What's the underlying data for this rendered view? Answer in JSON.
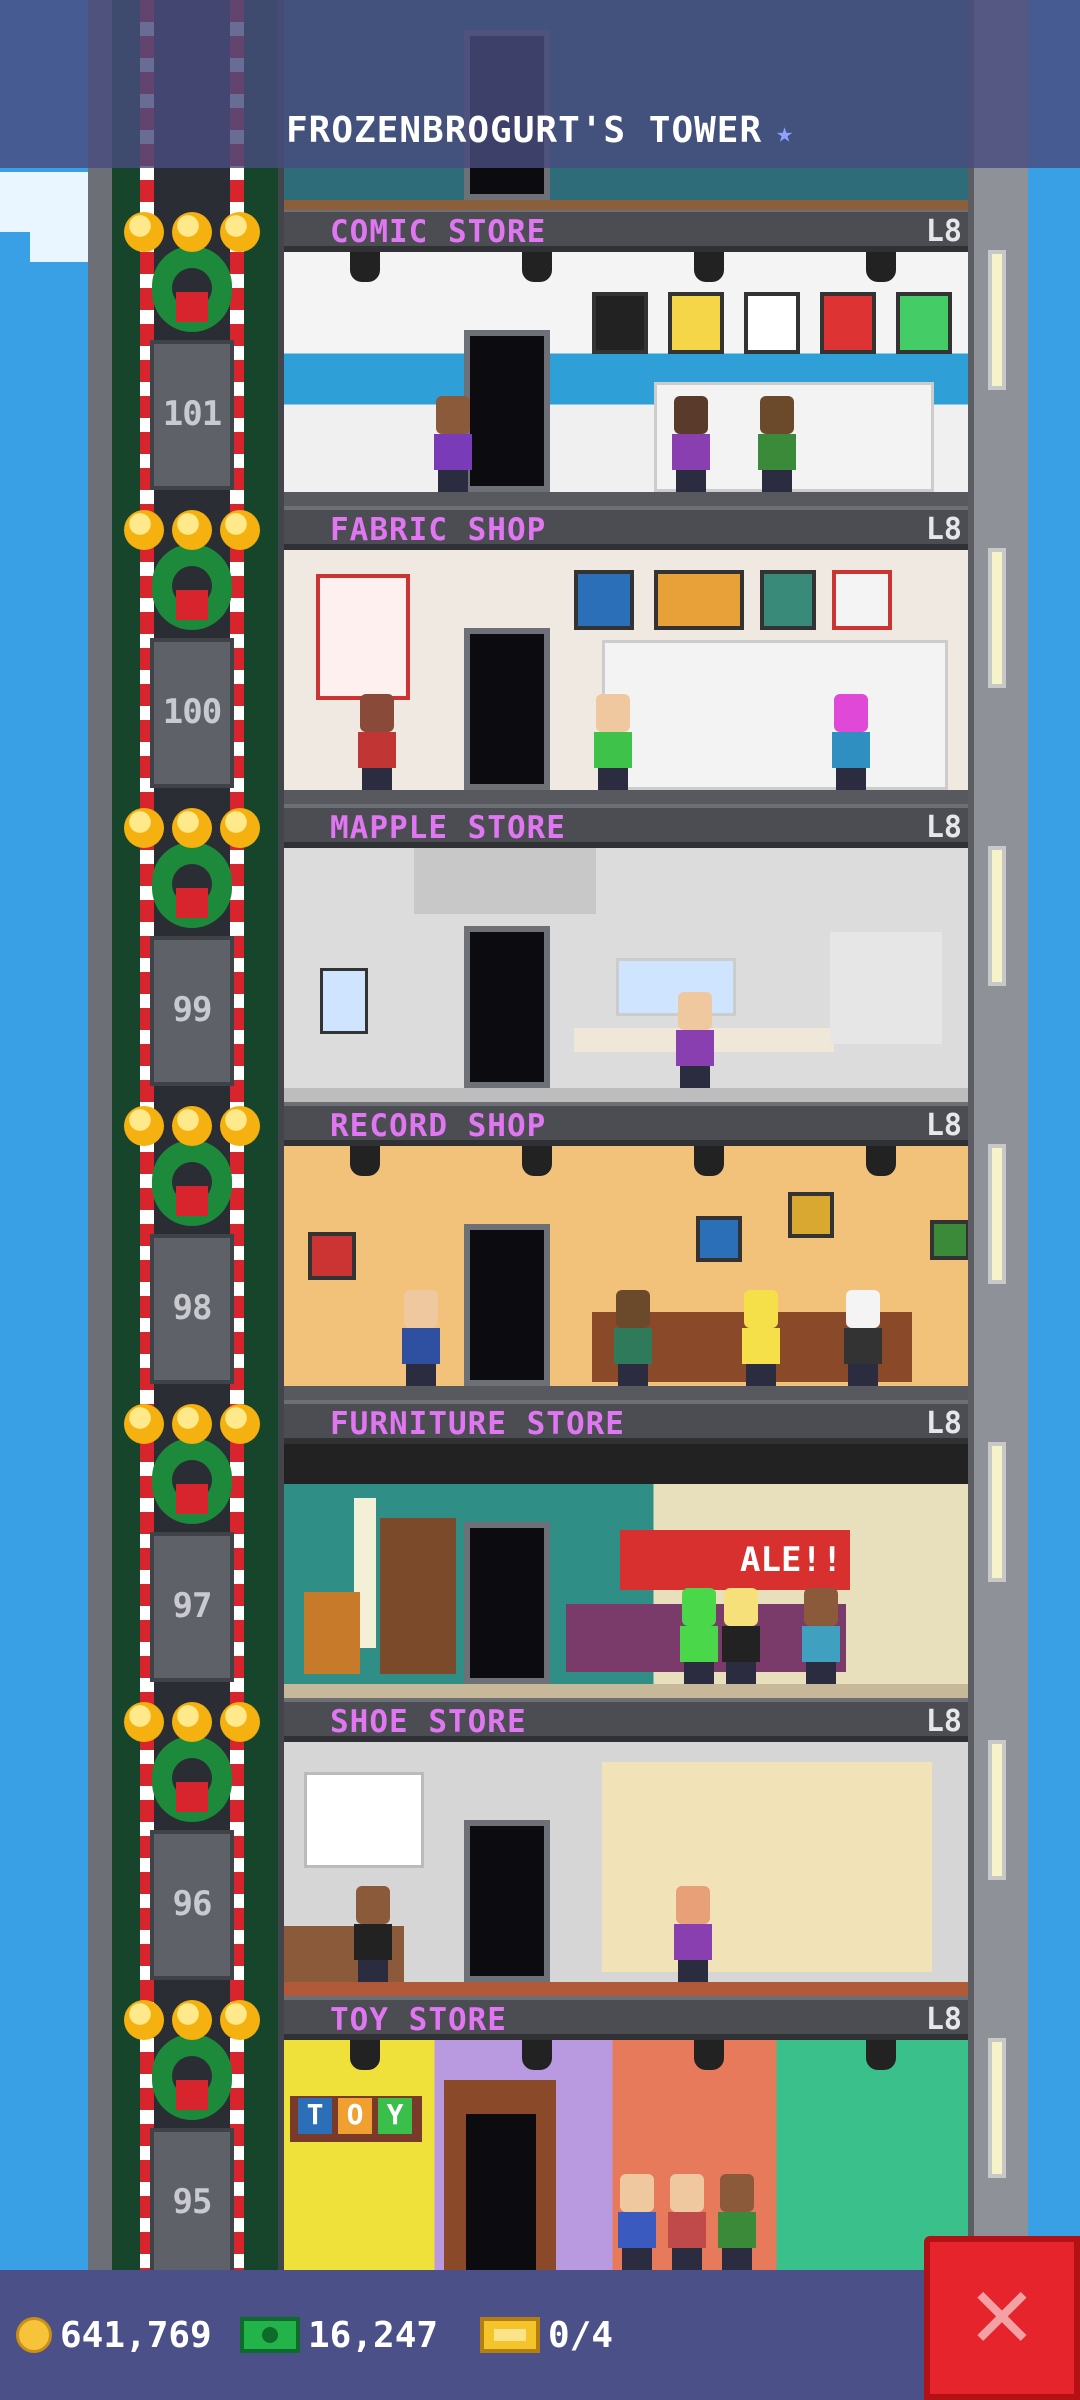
{
  "header": {
    "title": "FROZENBROGURT'S TOWER",
    "title_icon": "star-icon"
  },
  "elevator": {
    "floor_numbers": [
      "101",
      "100",
      "99",
      "98",
      "97",
      "96",
      "95"
    ]
  },
  "floors": [
    {
      "name": "COMIC STORE",
      "level": "L8"
    },
    {
      "name": "FABRIC SHOP",
      "level": "L8"
    },
    {
      "name": "MAPPLE STORE",
      "level": "L8"
    },
    {
      "name": "RECORD SHOP",
      "level": "L8"
    },
    {
      "name": "FURNITURE STORE",
      "level": "L8"
    },
    {
      "name": "SHOE STORE",
      "level": "L8"
    },
    {
      "name": "TOY STORE",
      "level": "L8"
    }
  ],
  "room_text": {
    "sale_sign": "ALE!!",
    "toy_letters": [
      "T",
      "O",
      "Y"
    ]
  },
  "footer": {
    "coins": "641,769",
    "bux": "16,247",
    "tickets": "0/4",
    "close_icon": "close-icon"
  },
  "colors": {
    "floor_name": "#e176f2",
    "close_button": "#e5252b",
    "footer_bg": "#4b5088"
  }
}
